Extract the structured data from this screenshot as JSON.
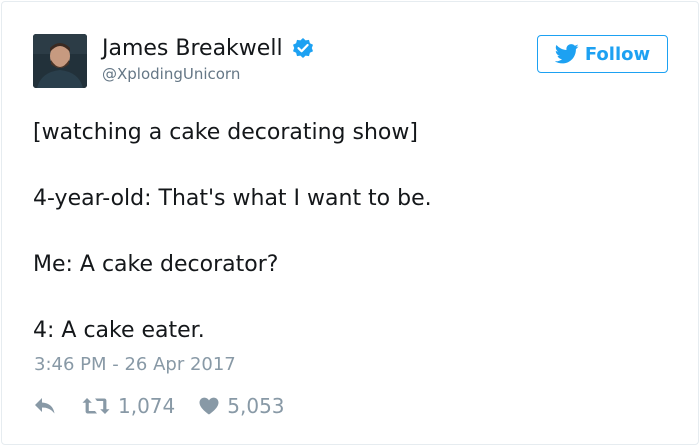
{
  "author": {
    "name": "James Breakwell",
    "handle": "@XplodingUnicorn",
    "verified": true
  },
  "follow_button": {
    "label": "Follow"
  },
  "tweet": {
    "lines": [
      "[watching a cake decorating show]",
      "4-year-old: That's what I want to be.",
      "Me: A cake decorator?",
      "4: A cake eater."
    ],
    "timestamp": "3:46 PM - 26 Apr 2017"
  },
  "actions": {
    "retweet_count": "1,074",
    "like_count": "5,053"
  },
  "colors": {
    "accent": "#1da1f2",
    "text": "#14171a",
    "muted": "#8899a6",
    "handle": "#657786",
    "border": "#e6ecf0"
  },
  "icons": {
    "verified": "verified-badge-icon",
    "follow": "twitter-bird-icon",
    "reply": "reply-icon",
    "retweet": "retweet-icon",
    "like": "heart-icon"
  }
}
